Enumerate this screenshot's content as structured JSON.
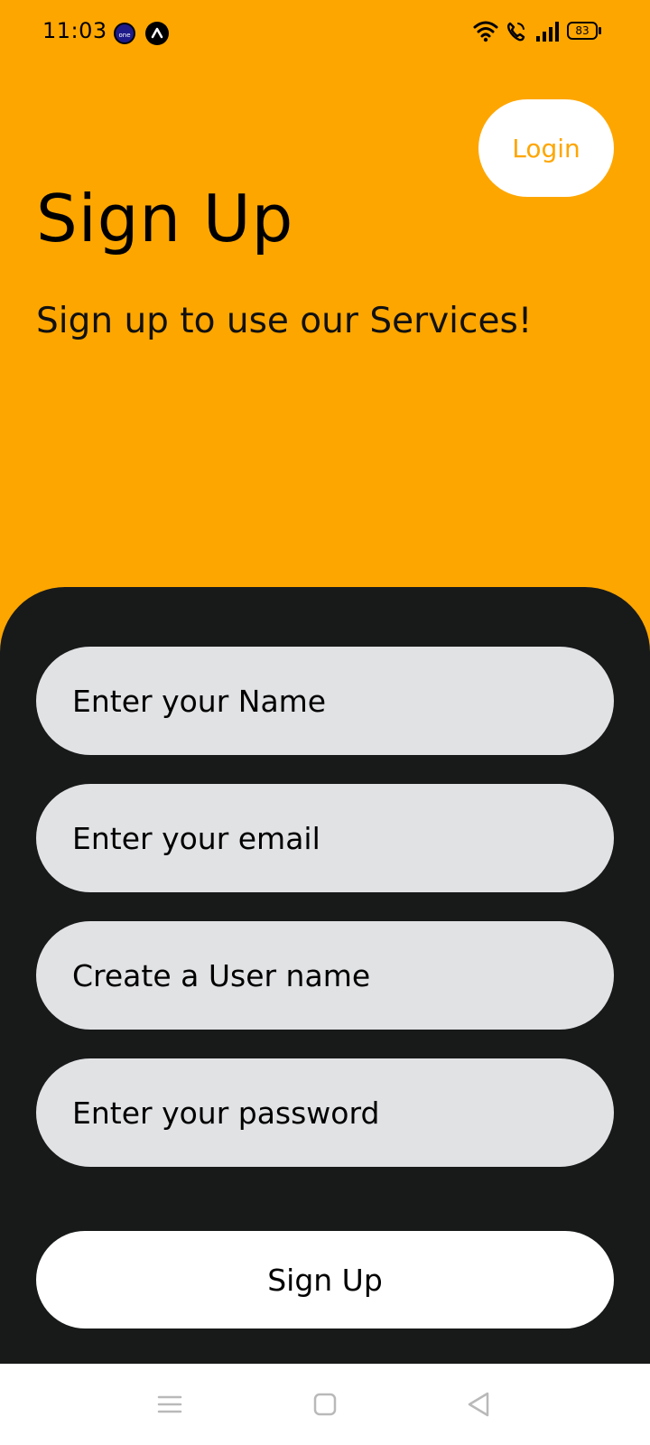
{
  "status_bar": {
    "time": "11:03",
    "app_icon_1_text": "one",
    "battery": "83"
  },
  "header": {
    "login_label": "Login",
    "title": "Sign Up",
    "subtitle": "Sign up to use our Services!"
  },
  "form": {
    "name_placeholder": "Enter your Name",
    "email_placeholder": "Enter your email",
    "username_placeholder": "Create a User name",
    "password_placeholder": "Enter your password",
    "submit_label": "Sign Up"
  },
  "colors": {
    "accent": "#fea600",
    "card": "#181a1a",
    "field": "#e1e2e4"
  },
  "nav": {
    "icons": [
      "menu-icon",
      "home-icon",
      "back-icon"
    ]
  }
}
